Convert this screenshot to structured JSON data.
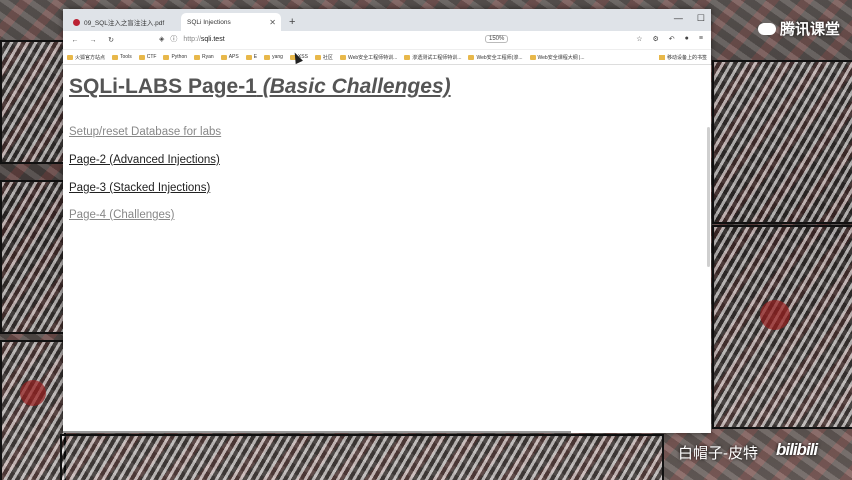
{
  "browser": {
    "tabs": [
      {
        "label": "09_SQL注入之盲注注入.pdf",
        "active": false
      },
      {
        "label": "SQLi Injections",
        "active": true
      }
    ],
    "new_tab": "+",
    "address": {
      "scheme": "http://",
      "host": "sqli.test"
    },
    "zoom": "150%",
    "bookmarks": [
      "火狐官方站点",
      "Tools",
      "CTF",
      "Python",
      "Ryan",
      "APS",
      "E",
      "yang",
      "XSS",
      "社区",
      "Web安全工程师特训...",
      "渗透测试工程师特训...",
      "Web安全工程师(渗...",
      "Web安全课程大纲 |..."
    ],
    "bookmarks_right": "移动设备上的书签"
  },
  "page": {
    "title_plain": "SQLi-LABS Page-1",
    "title_italic": "(Basic Challenges)",
    "links": [
      {
        "label": "Setup/reset Database for labs",
        "style": "gray"
      },
      {
        "label": "Page-2 (Advanced Injections)",
        "style": "dark"
      },
      {
        "label": "Page-3 (Stacked Injections)",
        "style": "dark"
      },
      {
        "label": "Page-4 (Challenges)",
        "style": "gray"
      }
    ]
  },
  "overlay": {
    "logo": "腾讯课堂",
    "credit": "白帽子-皮特",
    "site": "bilibili"
  },
  "colors": {
    "link_dark": "#222222",
    "link_gray": "#888888",
    "heading": "#555555"
  }
}
